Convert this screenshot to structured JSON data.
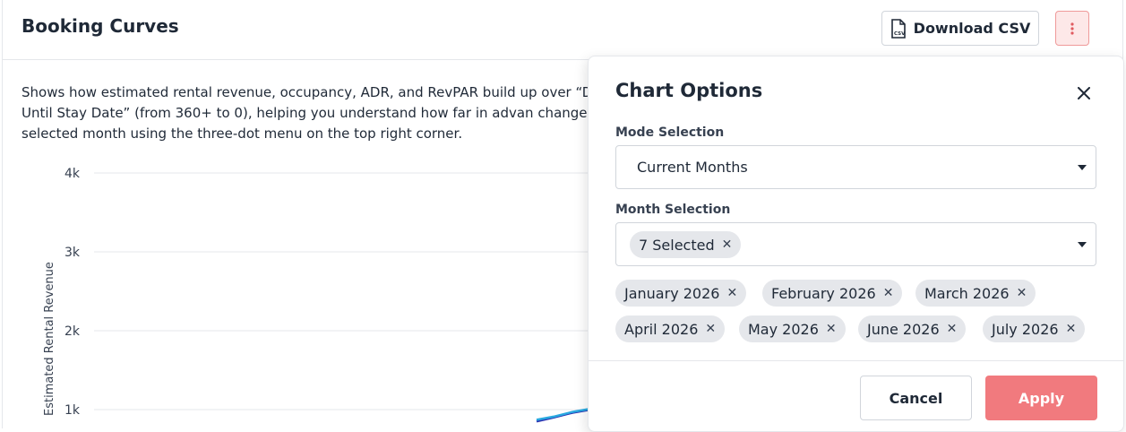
{
  "card": {
    "title": "Booking Curves",
    "download_label": "Download CSV",
    "csv_icon_text": "CSV",
    "description": "Shows how estimated rental revenue, occupancy, ADR, and RevPAR build up over “Days Until Stay Date” (from 360+ to 0), helping you understand how far in advan change the selected month using the three-dot menu on the top right corner."
  },
  "chart_data": {
    "type": "line",
    "ylabel": "Estimated Rental Revenue",
    "y_ticks": [
      "4k",
      "3k",
      "2k",
      "1k"
    ],
    "y_tick_values": [
      4000,
      3000,
      2000,
      1000
    ],
    "series": [
      {
        "color": "#2b2fb0",
        "values": [
          850,
          900,
          960,
          1000
        ]
      },
      {
        "color": "#29a8e0",
        "values": [
          870,
          910,
          970,
          1010
        ]
      }
    ],
    "grid": true
  },
  "options": {
    "title": "Chart Options",
    "mode_label": "Mode Selection",
    "mode_value": "Current Months",
    "month_label": "Month Selection",
    "selected_summary": "7 Selected",
    "months": [
      "January 2026",
      "February 2026",
      "March 2026",
      "April 2026",
      "May 2026",
      "June 2026",
      "July 2026"
    ],
    "cancel_label": "Cancel",
    "apply_label": "Apply"
  },
  "colors": {
    "accent": "#f17a7e",
    "kebab_bg": "#fde8e8",
    "chip_bg": "#e5e7eb"
  }
}
